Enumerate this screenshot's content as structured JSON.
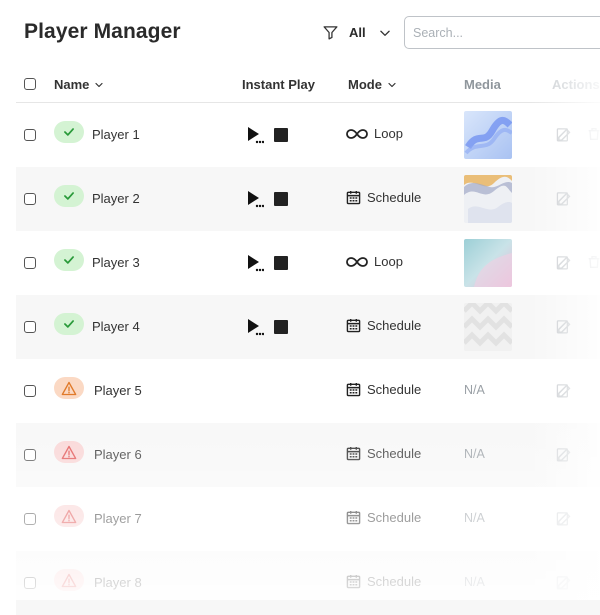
{
  "header": {
    "title": "Player Manager",
    "filter_label": "All",
    "search_placeholder": "Search..."
  },
  "columns": {
    "name": "Name",
    "instant_play": "Instant Play",
    "mode": "Mode",
    "media": "Media",
    "actions": "Actions"
  },
  "rows": [
    {
      "name": "Player 1",
      "status": "online",
      "mode": "Loop",
      "media": "blue-ribbon-thumbnail"
    },
    {
      "name": "Player 2",
      "status": "online",
      "mode": "Schedule",
      "media": "gold-swirl-thumbnail"
    },
    {
      "name": "Player 3",
      "status": "online",
      "mode": "Loop",
      "media": "teal-pink-gradient-thumbnail"
    },
    {
      "name": "Player 4",
      "status": "online",
      "mode": "Schedule",
      "media": "white-pattern-thumbnail"
    },
    {
      "name": "Player 5",
      "status": "warning",
      "mode": "Schedule",
      "media": "N/A"
    },
    {
      "name": "Player 6",
      "status": "error",
      "mode": "Schedule",
      "media": "N/A"
    },
    {
      "name": "Player 7",
      "status": "error",
      "mode": "Schedule",
      "media": "N/A"
    },
    {
      "name": "Player 8",
      "status": "error",
      "mode": "Schedule",
      "media": "N/A"
    }
  ],
  "colors": {
    "status_ok_bg": "#d4f3d3",
    "status_ok_icon": "#2a9a3a",
    "status_warn_bg": "#fbd9c4",
    "status_warn_icon": "#e07a2a",
    "status_err_bg": "#f9d3d3",
    "status_err_icon": "#e05050",
    "alt_row_bg": "#f7f7f7"
  },
  "icons": {
    "filter": "funnel-icon",
    "dropdown": "chevron-down-icon",
    "sort": "chevron-down-icon",
    "status_ok": "check-icon",
    "status_warn": "warning-icon",
    "play": "play-icon",
    "stop": "stop-icon",
    "loop": "infinity-icon",
    "schedule": "calendar-icon",
    "edit": "edit-icon",
    "delete": "trash-icon"
  }
}
